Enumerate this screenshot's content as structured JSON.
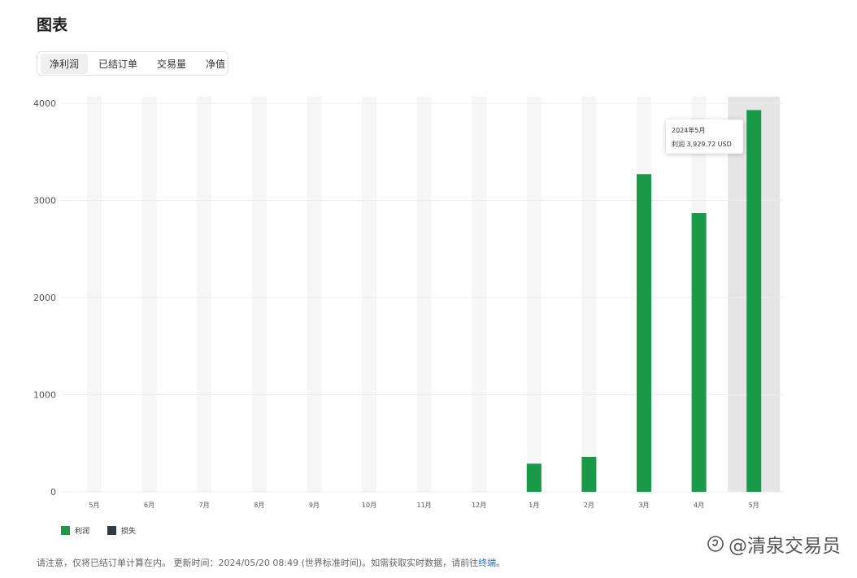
{
  "page": {
    "title": "图表"
  },
  "tabs": [
    {
      "label": "净利润",
      "active": true
    },
    {
      "label": "已结订单",
      "active": false
    },
    {
      "label": "交易量",
      "active": false
    },
    {
      "label": "净值",
      "active": false
    }
  ],
  "chart_data": {
    "type": "bar",
    "categories": [
      "5月",
      "6月",
      "7月",
      "8月",
      "9月",
      "10月",
      "11月",
      "12月",
      "1月",
      "2月",
      "3月",
      "4月",
      "5月"
    ],
    "series": [
      {
        "name": "利润",
        "color": "#1a9a48",
        "values": [
          0,
          0,
          0,
          0,
          0,
          0,
          0,
          0,
          290,
          360,
          3270,
          2870,
          3929.72
        ]
      },
      {
        "name": "损失",
        "color": "#2f3c48",
        "values": [
          0,
          0,
          0,
          0,
          0,
          0,
          0,
          0,
          0,
          0,
          0,
          0,
          0
        ]
      }
    ],
    "yticks": [
      0,
      1000,
      2000,
      3000,
      4000
    ],
    "ylim": [
      0,
      4000
    ],
    "grid": true,
    "legend": "bottom-left",
    "highlighted_index": 12
  },
  "tooltip": {
    "date": "2024年5月",
    "label": "利润",
    "value": "3,929.72 USD"
  },
  "legend": {
    "profit_label": "利润",
    "loss_label": "损失",
    "profit_color": "#1a9a48",
    "loss_color": "#2f3c48"
  },
  "footer": {
    "note": "请注意，仅将已结订单计算在内。 更新时间：2024/05/20 08:49 (世界标准时间)。如需获取实时数据，请前往",
    "link": "终端",
    "end": "。"
  },
  "watermark": {
    "text": "@清泉交易员"
  }
}
